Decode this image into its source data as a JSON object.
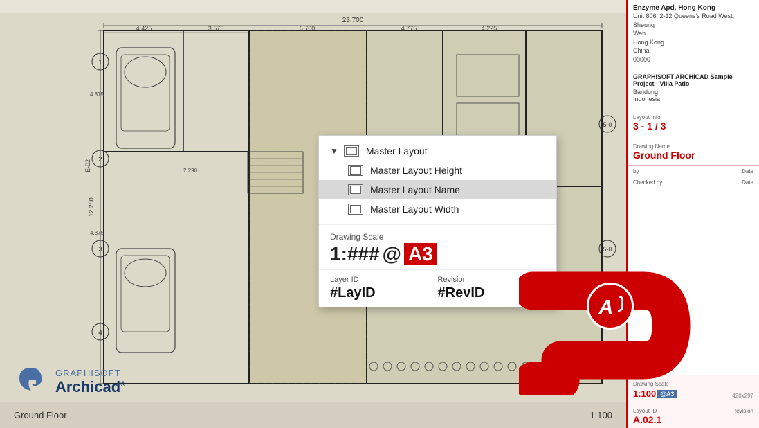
{
  "blueprint": {
    "title": "Ground Floor",
    "scale": "1:100",
    "dimension_top": "23.700",
    "dim_sections": [
      "4.425",
      "3.575",
      "6.700",
      "4.775",
      "4.225"
    ],
    "ground_floor_label": "Ground Floor"
  },
  "dropdown": {
    "header": "Master Layout",
    "items": [
      {
        "id": "master-layout",
        "label": "Master Layout",
        "is_header": true
      },
      {
        "id": "master-layout-height",
        "label": "Master Layout Height",
        "is_header": false
      },
      {
        "id": "master-layout-name",
        "label": "Master Layout Name",
        "is_header": false,
        "selected": true
      },
      {
        "id": "master-layout-width",
        "label": "Master Layout Width",
        "is_header": false
      }
    ],
    "scale_section": {
      "label": "Drawing Scale",
      "value": "1:###",
      "at_symbol": "@",
      "page_size": "A3"
    },
    "layer_section": {
      "layer_label": "Layer ID",
      "layer_value": "#LayID",
      "revision_label": "Revision",
      "revision_value": "#RevID"
    }
  },
  "right_panel": {
    "company": "Enzyme Apd, Hong Kong",
    "address_lines": [
      "Unit 806, 2-12 Queens's Road West, Sheung",
      "Wan",
      "Hong Kong",
      "China",
      "00000"
    ],
    "project_name": "GRAPHISOFT ARCHICAD Sample Project - Villa Patio",
    "location_lines": [
      "Bandung",
      "Indonesia"
    ],
    "layout_info_label": "Layout Info",
    "layout_info_value": "3 - 1 / 3",
    "drawing_name_label": "Drawing Name",
    "drawing_name_value": "Ground Floor",
    "by_label": "by",
    "date_label": "Date",
    "checked_by_label": "Checked by",
    "checked_date_label": "Date",
    "drawing_scale_label": "Drawing Scale",
    "drawing_scale_value": "1:100",
    "page_size_badge": "@A3",
    "drawing_size_note": "420x297",
    "layout_id_label": "Layout ID",
    "layout_id_value": "A.02.1",
    "revision_label": "Revision"
  },
  "logo": {
    "brand": "GRAPHISOFT",
    "product": "Archicad",
    "reg_mark": "®"
  },
  "red_logo": {
    "symbol": "A"
  }
}
